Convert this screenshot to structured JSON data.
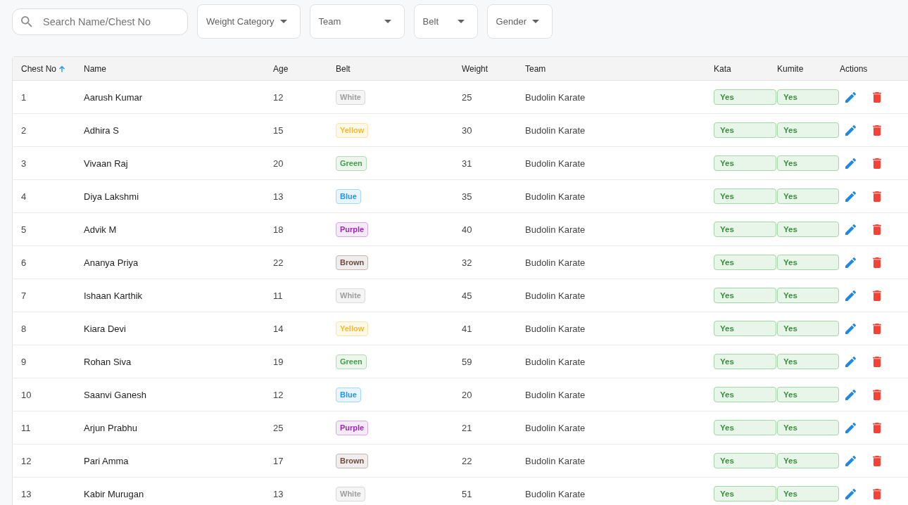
{
  "filters": {
    "search": {
      "placeholder": "Search Name/Chest No"
    },
    "dropdowns": [
      {
        "label": "Weight Category"
      },
      {
        "label": "Team"
      },
      {
        "label": "Belt"
      },
      {
        "label": "Gender"
      }
    ]
  },
  "table": {
    "columns": [
      {
        "label": "Chest No",
        "sorted": true
      },
      {
        "label": "Name",
        "sorted": false
      },
      {
        "label": "Age",
        "sorted": false
      },
      {
        "label": "Belt",
        "sorted": false
      },
      {
        "label": "Weight",
        "sorted": false
      },
      {
        "label": "Team",
        "sorted": false
      },
      {
        "label": "Kata",
        "sorted": false
      },
      {
        "label": "Kumite",
        "sorted": false
      },
      {
        "label": "Actions",
        "sorted": false
      }
    ],
    "rows": [
      {
        "chest_no": "1",
        "name": "Aarush Kumar",
        "age": "12",
        "belt": {
          "label": "White",
          "color": "#9e9e9e"
        },
        "weight": "25",
        "team": "Budolin Karate",
        "kata": "Yes",
        "kumite": "Yes"
      },
      {
        "chest_no": "2",
        "name": "Adhira S",
        "age": "15",
        "belt": {
          "label": "Yellow",
          "color": "#f9b825"
        },
        "weight": "30",
        "team": "Budolin Karate",
        "kata": "Yes",
        "kumite": "Yes"
      },
      {
        "chest_no": "3",
        "name": "Vivaan Raj",
        "age": "20",
        "belt": {
          "label": "Green",
          "color": "#43a047"
        },
        "weight": "31",
        "team": "Budolin Karate",
        "kata": "Yes",
        "kumite": "Yes"
      },
      {
        "chest_no": "4",
        "name": "Diya Lakshmi",
        "age": "13",
        "belt": {
          "label": "Blue",
          "color": "#2196f3"
        },
        "weight": "35",
        "team": "Budolin Karate",
        "kata": "Yes",
        "kumite": "Yes"
      },
      {
        "chest_no": "5",
        "name": "Advik M",
        "age": "18",
        "belt": {
          "label": "Purple",
          "color": "#9c27b0"
        },
        "weight": "40",
        "team": "Budolin Karate",
        "kata": "Yes",
        "kumite": "Yes"
      },
      {
        "chest_no": "6",
        "name": "Ananya Priya",
        "age": "22",
        "belt": {
          "label": "Brown",
          "color": "#6d4c41"
        },
        "weight": "32",
        "team": "Budolin Karate",
        "kata": "Yes",
        "kumite": "Yes"
      },
      {
        "chest_no": "7",
        "name": "Ishaan Karthik",
        "age": "11",
        "belt": {
          "label": "White",
          "color": "#9e9e9e"
        },
        "weight": "45",
        "team": "Budolin Karate",
        "kata": "Yes",
        "kumite": "Yes"
      },
      {
        "chest_no": "8",
        "name": "Kiara Devi",
        "age": "14",
        "belt": {
          "label": "Yellow",
          "color": "#f9b825"
        },
        "weight": "41",
        "team": "Budolin Karate",
        "kata": "Yes",
        "kumite": "Yes"
      },
      {
        "chest_no": "9",
        "name": "Rohan Siva",
        "age": "19",
        "belt": {
          "label": "Green",
          "color": "#43a047"
        },
        "weight": "59",
        "team": "Budolin Karate",
        "kata": "Yes",
        "kumite": "Yes"
      },
      {
        "chest_no": "10",
        "name": "Saanvi Ganesh",
        "age": "12",
        "belt": {
          "label": "Blue",
          "color": "#2196f3"
        },
        "weight": "20",
        "team": "Budolin Karate",
        "kata": "Yes",
        "kumite": "Yes"
      },
      {
        "chest_no": "11",
        "name": "Arjun Prabhu",
        "age": "25",
        "belt": {
          "label": "Purple",
          "color": "#9c27b0"
        },
        "weight": "21",
        "team": "Budolin Karate",
        "kata": "Yes",
        "kumite": "Yes"
      },
      {
        "chest_no": "12",
        "name": "Pari Amma",
        "age": "17",
        "belt": {
          "label": "Brown",
          "color": "#6d4c41"
        },
        "weight": "22",
        "team": "Budolin Karate",
        "kata": "Yes",
        "kumite": "Yes"
      },
      {
        "chest_no": "13",
        "name": "Kabir Murugan",
        "age": "13",
        "belt": {
          "label": "White",
          "color": "#9e9e9e"
        },
        "weight": "51",
        "team": "Budolin Karate",
        "kata": "Yes",
        "kumite": "Yes"
      }
    ]
  }
}
